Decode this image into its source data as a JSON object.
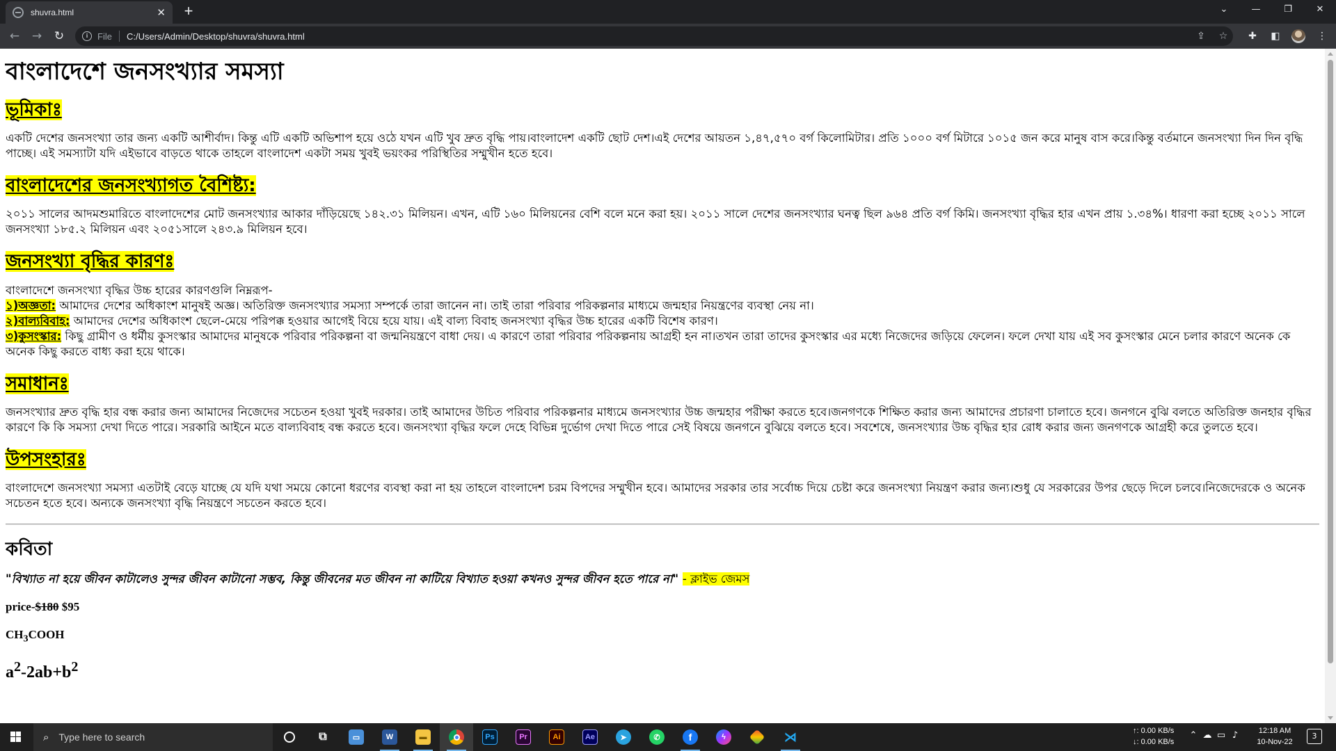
{
  "browser": {
    "tab_title": "shuvra.html",
    "tab_close": "✕",
    "new_tab": "+",
    "scheme_label": "File",
    "url": "C:/Users/Admin/Desktop/shuvra/shuvra.html"
  },
  "page": {
    "title": "বাংলাদেশে জনসংখ্যার সমস্যা",
    "sections": {
      "intro": {
        "heading": "ভূমিকাঃ",
        "text": "একটি দেশের জনসংখ্যা তার জন্য একটি আশীর্বাদ। কিন্তু এটি একটি অভিশাপ হয়ে ওঠে যখন এটি খুব দ্রুত বৃদ্ধি পায়।বাংলাদেশ একটি ছোট দেশ।এই দেশের আয়তন ১,৪৭,৫৭০ বর্গ কিলোমিটার। প্রতি ১০০০ বর্গ মিটারে ১০১৫ জন করে মানুষ বাস করে।কিন্তু বর্তমানে জনসংখ্যা দিন দিন বৃদ্ধি পাচ্ছে। এই সমস্যাটা যদি এইভাবে বাড়তে থাকে তাহলে বাংলাদেশ একটা সময় খুবই ভয়ংকর পরিস্থিতির সম্মুখীন হতে হবে।"
      },
      "features": {
        "heading": "বাংলাদেশের জনসংখ্যাগত বৈশিষ্ট্য:",
        "text": "২০১১ সালের আদমশুমারিতে বাংলাদেশের মোট জনসংখ্যার আকার দাঁড়িয়েছে ১৪২.৩১ মিলিয়ন।  এখন, এটি ১৬০ মিলিয়নের বেশি বলে মনে করা হয়।  ২০১১ সালে দেশের জনসংখ্যার ঘনত্ব ছিল ৯৬৪ প্রতি বর্গ কিমি। জনসংখ্যা বৃদ্ধির হার এখন প্রায় ১.৩৪%।  ধারণা করা হচ্ছে ২০১১ সালে জনসংখ্যা ১৮৫.২ মিলিয়ন এবং ২০৫১সালে ২৪৩.৯ মিলিয়ন হবে।"
      },
      "causes": {
        "heading": "জনসংখ্যা বৃদ্ধির কারণঃ",
        "intro": "বাংলাদেশে জনসংখ্যা বৃদ্ধির উচ্চ হারের কারণগুলি নিম্নরূপ-",
        "items": [
          {
            "label": "১)অজ্ঞতা:",
            "text": " আমাদের দেশের অধিকাংশ মানুষই অজ্ঞ।  অতিরিক্ত জনসংখ্যার সমস্যা সম্পর্কে তারা জানেন না।  তাই তারা পরিবার পরিকল্পনার মাধ্যমে জন্মহার নিয়ন্ত্রণের ব্যবস্থা নেয় না।"
          },
          {
            "label": "২)বাল্যবিবাহ:",
            "text": " আমাদের দেশের অধিকাংশ ছেলে-মেয়ে পরিপক্ক হওয়ার আগেই বিয়ে হয়ে যায়।  এই বাল্য বিবাহ জনসংখ্যা বৃদ্ধির উচ্চ হারের একটি বিশেষ কারণ।"
          },
          {
            "label": "৩)কুসংস্কার:",
            "text": " কিছু গ্রামীণ ও ধর্মীয় কুসংস্কার আমাদের মানুষকে পরিবার পরিকল্পনা বা জন্মনিয়ন্ত্রণে বাধা দেয়।  এ কারণে তারা পরিবার পরিকল্পনায় আগ্রহী হন না।তখন তারা তাদের কুসংস্কার এর মধ্যে নিজেদের জড়িয়ে ফেলেন। ফলে দেখা যায় এই সব কুসংস্কার মেনে চলার কারণে অনেক কে অনেক কিছু করতে বাধ্য করা হয়ে থাকে।"
          }
        ]
      },
      "solution": {
        "heading": "সমাধানঃ",
        "text": "জনসংখ্যার দ্রুত বৃদ্ধি হার বন্ধ করার জন্য আমাদের নিজেদের সচেতন হওয়া খুবই দরকার। তাই আমাদের উচিত পরিবার পরিকল্পনার মাধ্যমে জনসংখ্যার উচ্চ জন্মহার পরীক্ষা করতে হবে।জনগণকে শিক্ষিত করার জন্য আমাদের প্রচারণা চালাতে হবে। জনগনে বুঝি বলতে অতিরিক্ত জনহার বৃদ্ধির কারণে কি কি সমস্যা দেখা দিতে পারে। সরকারি আইনে মতে বাল্যবিবাহ বন্ধ করতে হবে। জনসংখ্যা বৃদ্ধির ফলে দেহে বিভিন্ন দুর্ভোগ দেখা দিতে পারে সেই বিষয়ে জনগনে বুঝিয়ে বলতে হবে। সবশেষে, জনসংখ্যার উচ্চ বৃদ্ধির হার রোধ করার জন্য জনগণকে আগ্রহী করে তুলতে হবে।"
      },
      "conclusion": {
        "heading": "উপসংহারঃ",
        "text": "বাংলাদেশে জনসংখ্যা সমস্যা এতটাই বেড়ে যাচ্ছে যে যদি যথা সময়ে কোনো ধরণের ব্যবস্থা করা না হয় তাহলে বাংলাদেশ চরম বিপদের সম্মুখীন হবে। আমাদের সরকার তার সর্বোচ্চ দিয়ে চেষ্টা করে জনসংখ্যা নিয়ন্ত্রণ করার জন্য।শুধু যে সরকারের উপর ছেড়ে দিলে চলবে।নিজেদেরকে ও অনেক সচেতন হতে হবে। অন্যকে জনসংখ্যা বৃদ্ধি নিয়ন্ত্রণে সচতেন করতে হবে।"
      }
    },
    "poem": {
      "heading": "কবিতা",
      "quote": "\"বিখ্যাত না হয়ে জীবন কাটালেও সুন্দর জীবন কাটানো সম্ভব, কিন্তু জীবনের মত জীবন না কাটিয়ে বিখ্যাত হওয়া কখনও সুন্দর জীবন হতে পারে না\"",
      "author": "- ক্লাইভ জেমস"
    },
    "price": {
      "label": "price-",
      "old": "$180",
      "new": "$95"
    },
    "chemical": {
      "part1": "CH",
      "sub": "3",
      "part2": "COOH"
    },
    "formula": {
      "a": "a",
      "sup1": "2",
      "mid": "-2ab+b",
      "sup2": "2"
    }
  },
  "taskbar": {
    "search_placeholder": "Type here to search",
    "net_up": "↑: 0.00 KB/s",
    "net_down": "↓: 0.00 KB/s",
    "time": "12:18 AM",
    "date": "10-Nov-22",
    "notification_count": "3"
  },
  "colors": {
    "highlight": "#ffff00",
    "chrome_dark": "#202124",
    "chrome_toolbar": "#35363a",
    "taskbar": "#1f1f1f"
  }
}
